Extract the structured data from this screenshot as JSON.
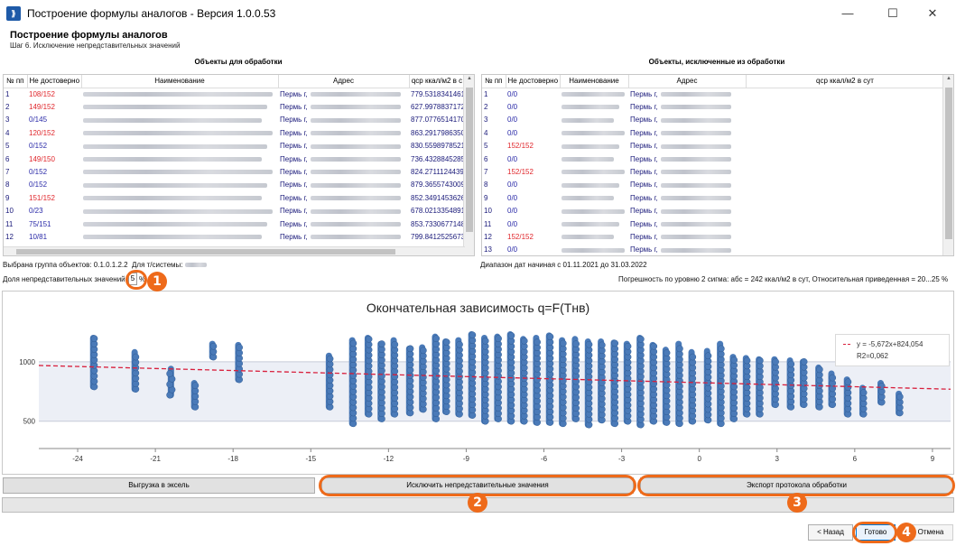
{
  "window": {
    "title": "Построение формулы аналогов - Версия 1.0.0.53",
    "minimize": "—",
    "maximize": "☐",
    "close": "✕"
  },
  "header": {
    "title": "Построение формулы аналогов",
    "subtitle": "Шаг 6. Исключение непредставительных значений"
  },
  "left_panel": {
    "title": "Объекты для обработки",
    "columns": [
      "№ пп",
      "Не достоверно",
      "Наименование",
      "Адрес",
      "qср ккал/м2 в с"
    ],
    "rows": [
      {
        "n": "1",
        "nd": "108/152",
        "nd_red": true,
        "addr": "Пермь г,",
        "q": "779.5318341461"
      },
      {
        "n": "2",
        "nd": "149/152",
        "nd_red": true,
        "addr": "Пермь г,",
        "q": "627.9978837172"
      },
      {
        "n": "3",
        "nd": "0/145",
        "nd_red": false,
        "addr": "Пермь г,",
        "q": "877.0776514170"
      },
      {
        "n": "4",
        "nd": "120/152",
        "nd_red": true,
        "addr": "Пермь г,",
        "q": "863.2917986350"
      },
      {
        "n": "5",
        "nd": "0/152",
        "nd_red": false,
        "addr": "Пермь г,",
        "q": "830.5598978521"
      },
      {
        "n": "6",
        "nd": "149/150",
        "nd_red": true,
        "addr": "Пермь г,",
        "q": "736.4328845285"
      },
      {
        "n": "7",
        "nd": "0/152",
        "nd_red": false,
        "addr": "Пермь г,",
        "q": "824.2711124439"
      },
      {
        "n": "8",
        "nd": "0/152",
        "nd_red": false,
        "addr": "Пермь г,",
        "q": "879.3655743009"
      },
      {
        "n": "9",
        "nd": "151/152",
        "nd_red": true,
        "addr": "Пермь г,",
        "q": "852.3491453626"
      },
      {
        "n": "10",
        "nd": "0/23",
        "nd_red": false,
        "addr": "Пермь г,",
        "q": "678.0213354891"
      },
      {
        "n": "11",
        "nd": "75/151",
        "nd_red": false,
        "addr": "Пермь г,",
        "q": "853.7330677148"
      },
      {
        "n": "12",
        "nd": "10/81",
        "nd_red": false,
        "addr": "Пермь г,",
        "q": "799.8412525673"
      }
    ]
  },
  "right_panel": {
    "title": "Объекты, исключенные из обработки",
    "columns": [
      "№ пп",
      "Не достоверно",
      "Наименование",
      "Адрес",
      "qср ккал/м2 в сут"
    ],
    "rows": [
      {
        "n": "1",
        "nd": "0/0",
        "nd_red": false,
        "addr": "Пермь г,"
      },
      {
        "n": "2",
        "nd": "0/0",
        "nd_red": false,
        "addr": "Пермь г,"
      },
      {
        "n": "3",
        "nd": "0/0",
        "nd_red": false,
        "addr": "Пермь г,"
      },
      {
        "n": "4",
        "nd": "0/0",
        "nd_red": false,
        "addr": "Пермь г,"
      },
      {
        "n": "5",
        "nd": "152/152",
        "nd_red": true,
        "addr": "Пермь г,"
      },
      {
        "n": "6",
        "nd": "0/0",
        "nd_red": false,
        "addr": "Пермь г,"
      },
      {
        "n": "7",
        "nd": "152/152",
        "nd_red": true,
        "addr": "Пермь г,"
      },
      {
        "n": "8",
        "nd": "0/0",
        "nd_red": false,
        "addr": "Пермь г,"
      },
      {
        "n": "9",
        "nd": "0/0",
        "nd_red": false,
        "addr": "Пермь г,"
      },
      {
        "n": "10",
        "nd": "0/0",
        "nd_red": false,
        "addr": "Пермь г,"
      },
      {
        "n": "11",
        "nd": "0/0",
        "nd_red": false,
        "addr": "Пермь г,"
      },
      {
        "n": "12",
        "nd": "152/152",
        "nd_red": true,
        "addr": "Пермь г,"
      },
      {
        "n": "13",
        "nd": "0/0",
        "nd_red": false,
        "addr": "Пермь г,"
      }
    ]
  },
  "info": {
    "group_label": "Выбрана группа объектов: 0.1.0.1.2.2",
    "system_label": "Для т/системы:",
    "date_range": "Диапазон дат начиная с 01.11.2021 до 31.03.2022",
    "share_label": "Доля непредставительных значений",
    "share_value": "5",
    "share_unit": "%",
    "error_text": "Погрешность по уровню 2 сигма: абс = 242 ккал/м2 в сут, Относительная приведенная = 20...25 %"
  },
  "markers": [
    "1",
    "2",
    "3",
    "4"
  ],
  "colors": {
    "points": "#4a7ab8",
    "trendline": "#d81f3c",
    "band": "#eceff6",
    "accent_marker": "#ee6a1a",
    "red_text": "#e0262b",
    "blue_text": "#2a2aa8"
  },
  "chart_data": {
    "type": "scatter",
    "title": "Окончательная зависимость q=F(Tнв)",
    "xlabel": "",
    "ylabel": "",
    "xlim": [
      -25.5,
      9.7
    ],
    "ylim": [
      270,
      1310
    ],
    "x_ticks": [
      -24,
      -21,
      -18,
      -15,
      -12,
      -9,
      -6,
      -3,
      0,
      3,
      6,
      9
    ],
    "y_ticks": [
      500,
      1000
    ],
    "y_band": [
      500,
      1000
    ],
    "trendline": {
      "slope": -5.672,
      "intercept": 824.054
    },
    "legend": {
      "equation": "y = -5,672x+824,054",
      "r2": "R2=0,062",
      "position": "top-right"
    },
    "columns": [
      {
        "x": -23.4,
        "low": 790,
        "high": 1200
      },
      {
        "x": -21.8,
        "low": 770,
        "high": 1080
      },
      {
        "x": -20.4,
        "low": 720,
        "high": 940
      },
      {
        "x": -19.5,
        "low": 620,
        "high": 820
      },
      {
        "x": -18.8,
        "low": 1040,
        "high": 1150
      },
      {
        "x": -17.8,
        "low": 850,
        "high": 1140
      },
      {
        "x": -14.3,
        "low": 620,
        "high": 1050
      },
      {
        "x": -13.4,
        "low": 480,
        "high": 1180
      },
      {
        "x": -12.8,
        "low": 560,
        "high": 1200
      },
      {
        "x": -12.3,
        "low": 520,
        "high": 1150
      },
      {
        "x": -11.8,
        "low": 560,
        "high": 1180
      },
      {
        "x": -11.2,
        "low": 570,
        "high": 1110
      },
      {
        "x": -10.7,
        "low": 600,
        "high": 1120
      },
      {
        "x": -10.2,
        "low": 520,
        "high": 1210
      },
      {
        "x": -9.8,
        "low": 580,
        "high": 1170
      },
      {
        "x": -9.3,
        "low": 560,
        "high": 1180
      },
      {
        "x": -8.8,
        "low": 550,
        "high": 1230
      },
      {
        "x": -8.3,
        "low": 500,
        "high": 1200
      },
      {
        "x": -7.8,
        "low": 520,
        "high": 1210
      },
      {
        "x": -7.3,
        "low": 500,
        "high": 1230
      },
      {
        "x": -6.8,
        "low": 500,
        "high": 1190
      },
      {
        "x": -6.3,
        "low": 490,
        "high": 1200
      },
      {
        "x": -5.8,
        "low": 490,
        "high": 1220
      },
      {
        "x": -5.3,
        "low": 480,
        "high": 1180
      },
      {
        "x": -4.8,
        "low": 520,
        "high": 1190
      },
      {
        "x": -4.3,
        "low": 470,
        "high": 1170
      },
      {
        "x": -3.8,
        "low": 510,
        "high": 1170
      },
      {
        "x": -3.3,
        "low": 480,
        "high": 1160
      },
      {
        "x": -2.8,
        "low": 500,
        "high": 1150
      },
      {
        "x": -2.3,
        "low": 470,
        "high": 1200
      },
      {
        "x": -1.8,
        "low": 500,
        "high": 1140
      },
      {
        "x": -1.3,
        "low": 490,
        "high": 1100
      },
      {
        "x": -0.8,
        "low": 480,
        "high": 1150
      },
      {
        "x": -0.3,
        "low": 500,
        "high": 1080
      },
      {
        "x": 0.3,
        "low": 510,
        "high": 1090
      },
      {
        "x": 0.8,
        "low": 480,
        "high": 1150
      },
      {
        "x": 1.3,
        "low": 520,
        "high": 1040
      },
      {
        "x": 1.8,
        "low": 560,
        "high": 1030
      },
      {
        "x": 2.3,
        "low": 560,
        "high": 1020
      },
      {
        "x": 2.9,
        "low": 640,
        "high": 1020
      },
      {
        "x": 3.5,
        "low": 620,
        "high": 1010
      },
      {
        "x": 4.0,
        "low": 640,
        "high": 1000
      },
      {
        "x": 4.6,
        "low": 620,
        "high": 950
      },
      {
        "x": 5.1,
        "low": 640,
        "high": 900
      },
      {
        "x": 5.7,
        "low": 560,
        "high": 850
      },
      {
        "x": 6.3,
        "low": 560,
        "high": 780
      },
      {
        "x": 7.0,
        "low": 660,
        "high": 820
      },
      {
        "x": 7.7,
        "low": 570,
        "high": 730
      }
    ]
  },
  "buttons": {
    "export_excel": "Выгрузка в эксель",
    "exclude": "Исключить непредставительные значения",
    "export_protocol": "Экспорт протокола обработки",
    "back": "< Назад",
    "done": "Готово",
    "cancel": "Отмена"
  },
  "progress": {
    "value": 0
  }
}
